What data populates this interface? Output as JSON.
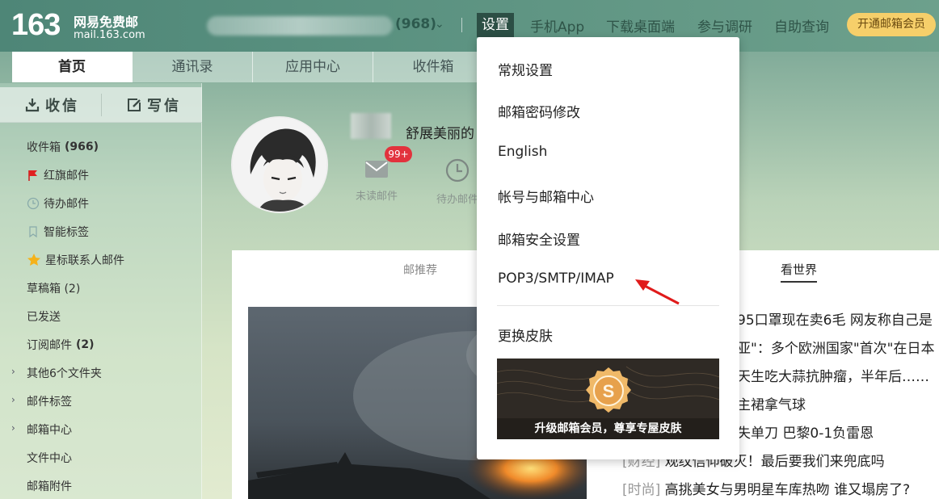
{
  "logo": {
    "number": "163",
    "name": "网易免费邮",
    "domain": "mail.163.com"
  },
  "account": {
    "unread_count": "(968)"
  },
  "topnav": {
    "settings": "设置",
    "mobile_app": "手机App",
    "desktop": "下载桌面端",
    "survey": "参与调研",
    "self_service": "自助查询",
    "vip": "开通邮箱会员"
  },
  "tabs": [
    "首页",
    "通讯录",
    "应用中心",
    "收件箱"
  ],
  "compose": {
    "receive": "收信",
    "write": "写信"
  },
  "folders": [
    {
      "label": "收件箱",
      "count": "(966)"
    },
    {
      "label": "红旗邮件"
    },
    {
      "label": "待办邮件"
    },
    {
      "label": "智能标签"
    },
    {
      "label": "星标联系人邮件"
    },
    {
      "label": "草稿箱 (2)"
    },
    {
      "label": "已发送"
    },
    {
      "label": "订阅邮件",
      "count": "(2)"
    },
    {
      "label": "其他6个文件夹"
    },
    {
      "label": "邮件标签"
    },
    {
      "label": "邮箱中心"
    },
    {
      "label": "文件中心"
    },
    {
      "label": "邮箱附件"
    }
  ],
  "profile": {
    "greeting": "舒展美丽的",
    "badge": "99+",
    "unread_label": "未读邮件",
    "todo_label": "待办邮件"
  },
  "card": {
    "tab_recommend": "邮推荐",
    "tab_world": "看世界",
    "news": [
      {
        "text": "95口罩现在卖6毛 网友称自己是"
      },
      {
        "text": "亚\"：多个欧洲国家\"首次\"在日本"
      },
      {
        "text": "天生吃大蒜抗肿瘤，半年后……"
      },
      {
        "text": "主裙拿气球"
      },
      {
        "text": "失单刀 巴黎0-1负雷恩"
      },
      {
        "cat": "[财经]",
        "text": " 观纹信仰破灭！最后要我们来兜底吗"
      },
      {
        "cat": "[时尚]",
        "text": " 高挑美女与男明星车库热吻 谁又塌房了?"
      }
    ]
  },
  "settings_menu": {
    "items": [
      "常规设置",
      "邮箱密码修改",
      "English",
      "帐号与邮箱中心",
      "邮箱安全设置",
      "POP3/SMTP/IMAP",
      "更换皮肤"
    ],
    "banner_text": "升级邮箱会员，尊享专屋皮肤"
  }
}
